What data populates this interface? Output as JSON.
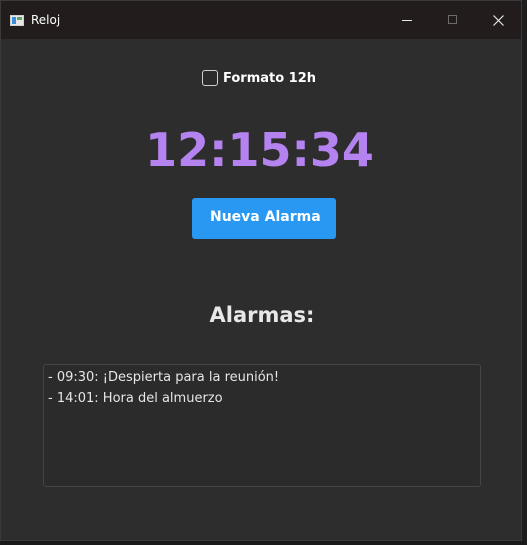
{
  "window": {
    "title": "Reloj",
    "icon": "window-app-icon"
  },
  "controls": {
    "minimize_icon": "minimize-icon",
    "maximize_icon": "maximize-icon",
    "close_icon": "close-icon"
  },
  "format": {
    "label": "Formato 12h",
    "checked": false
  },
  "clock": {
    "time": "12:15:34",
    "color": "#b583f0"
  },
  "new_alarm": {
    "label": "Nueva Alarma",
    "color": "#2898f3"
  },
  "alarms": {
    "title": "Alarmas:",
    "items": [
      "- 09:30: ¡Despierta para la reunión!",
      "- 14:01: Hora del almuerzo"
    ]
  }
}
